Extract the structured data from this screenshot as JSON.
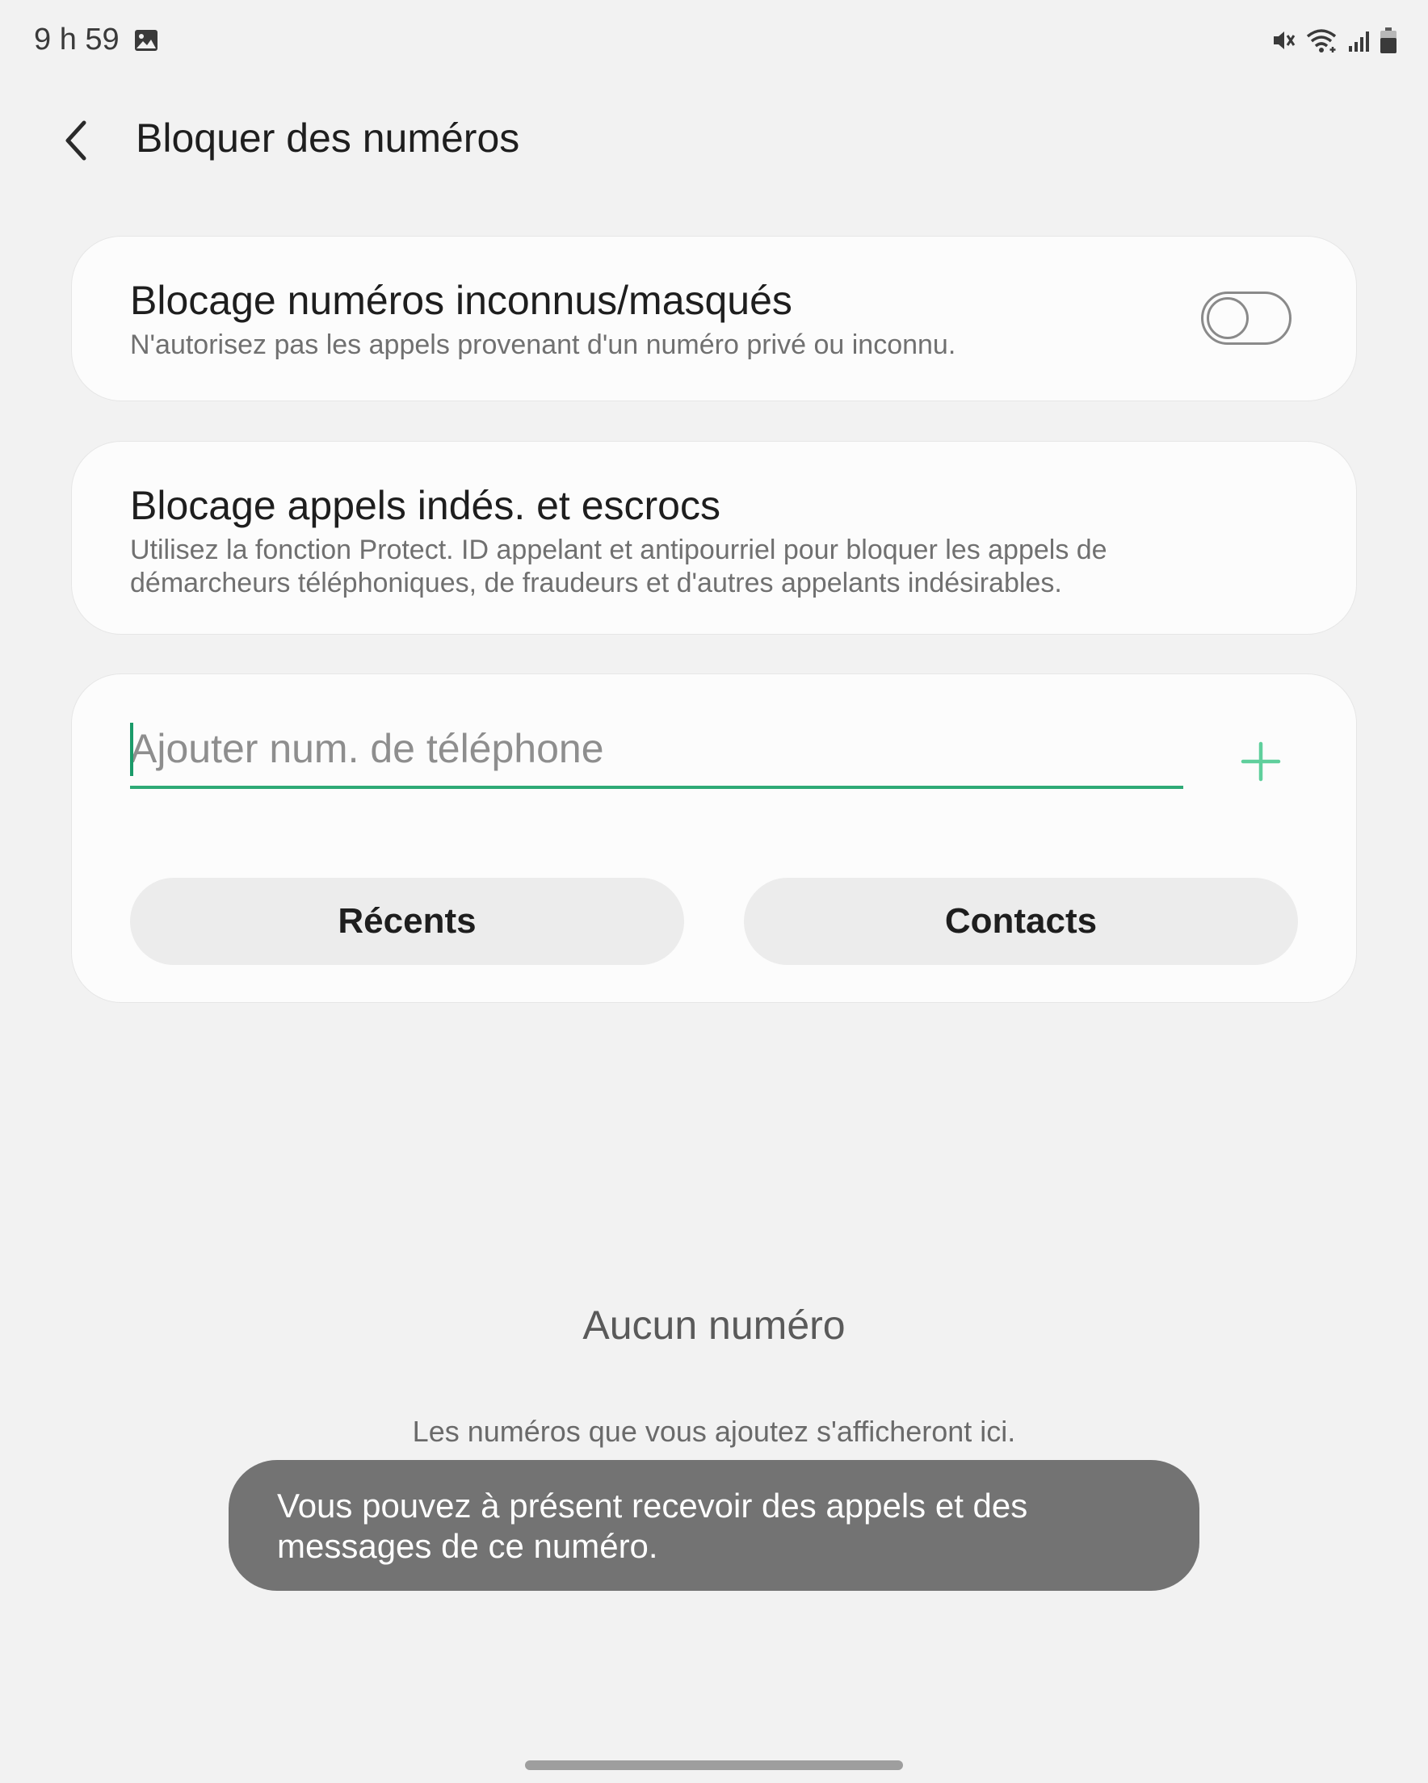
{
  "status_bar": {
    "time": "9 h 59",
    "icons": [
      "gallery-icon",
      "mute-icon",
      "wifi-icon",
      "signal-icon",
      "battery-icon"
    ]
  },
  "header": {
    "back_icon": "chevron-left-icon",
    "title": "Bloquer des numéros"
  },
  "settings": {
    "unknown_private": {
      "title": "Blocage numéros inconnus/masqués",
      "description": "N'autorisez pas les appels provenant d'un numéro privé ou inconnu.",
      "toggle_on": false
    },
    "spam_scam": {
      "title": "Blocage appels indés. et escrocs",
      "description": "Utilisez la fonction Protect. ID appelant et antipourriel pour bloquer les appels de démarcheurs téléphoniques, de fraudeurs et d'autres appelants indésirables."
    }
  },
  "add_number": {
    "placeholder": "Ajouter num. de téléphone",
    "value": "",
    "add_icon": "plus-icon",
    "recents_label": "Récents",
    "contacts_label": "Contacts"
  },
  "empty_state": {
    "title": "Aucun numéro",
    "description": "Les numéros que vous ajoutez s'afficheront ici."
  },
  "toast": {
    "message": "Vous pouvez à présent recevoir des appels et des messages de ce numéro."
  },
  "colors": {
    "accent": "#2eaa76",
    "background": "#f2f2f2",
    "card": "#fcfcfc",
    "toast": "#737373"
  }
}
